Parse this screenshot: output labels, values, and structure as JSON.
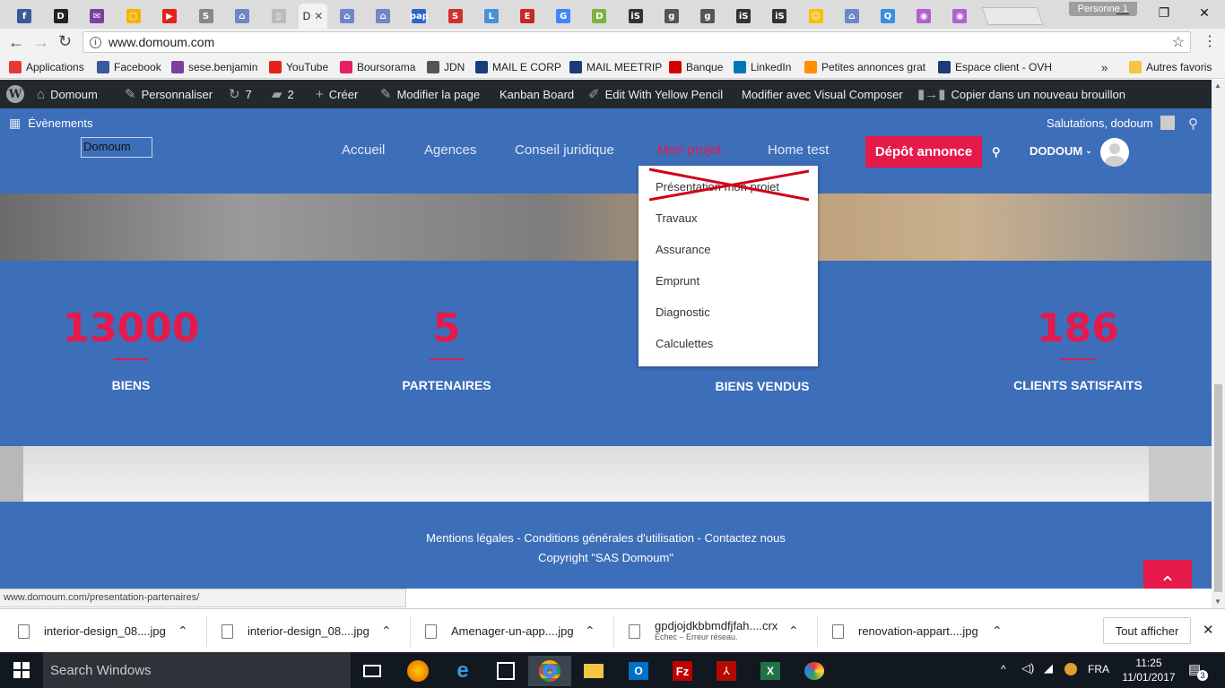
{
  "browser": {
    "profile_label": "Personne 1",
    "active_tab_title": "D",
    "tabs": [
      {
        "icon": "facebook-icon",
        "color": "#3b5998",
        "glyph": "f"
      },
      {
        "icon": "d-icon",
        "color": "#222222",
        "glyph": "D"
      },
      {
        "icon": "mail-icon",
        "color": "#7b3fa0",
        "glyph": "✉"
      },
      {
        "icon": "keep-icon",
        "color": "#f6b400",
        "glyph": "▢"
      },
      {
        "icon": "youtube-icon",
        "color": "#e62117",
        "glyph": "▶"
      },
      {
        "icon": "audio-tab-icon",
        "color": "#888888",
        "glyph": "S"
      },
      {
        "icon": "house-icon",
        "color": "#6f86c8",
        "glyph": "⌂"
      },
      {
        "icon": "doc-icon",
        "color": "#bbbbbb",
        "glyph": "▯"
      }
    ],
    "tabs_right": [
      {
        "icon": "house-icon",
        "color": "#6f86c8",
        "glyph": "⌂"
      },
      {
        "icon": "house-icon",
        "color": "#6f86c8",
        "glyph": "⌂"
      },
      {
        "icon": "pap-icon",
        "color": "#2a66c9",
        "glyph": "pap"
      },
      {
        "icon": "s-icon",
        "color": "#d32f2f",
        "glyph": "S"
      },
      {
        "icon": "li-icon",
        "color": "#4a90d9",
        "glyph": "L"
      },
      {
        "icon": "e-icon",
        "color": "#c62828",
        "glyph": "E"
      },
      {
        "icon": "google-icon",
        "color": "#4285f4",
        "glyph": "G"
      },
      {
        "icon": "d-green-icon",
        "color": "#7cb342",
        "glyph": "D"
      },
      {
        "icon": "is-icon",
        "color": "#333333",
        "glyph": "iS"
      },
      {
        "icon": "g-icon",
        "color": "#555555",
        "glyph": "g"
      },
      {
        "icon": "g-icon",
        "color": "#555555",
        "glyph": "g"
      },
      {
        "icon": "is-icon",
        "color": "#333333",
        "glyph": "iS"
      },
      {
        "icon": "is-icon",
        "color": "#333333",
        "glyph": "iS"
      },
      {
        "icon": "smile-icon",
        "color": "#f4c20d",
        "glyph": "☺"
      },
      {
        "icon": "house-icon",
        "color": "#6f86c8",
        "glyph": "⌂"
      },
      {
        "icon": "search-tab-icon",
        "color": "#3b8ee0",
        "glyph": "Q"
      },
      {
        "icon": "circle-icon",
        "color": "#b35fd0",
        "glyph": "◉"
      },
      {
        "icon": "circle-icon",
        "color": "#b35fd0",
        "glyph": "◉"
      }
    ],
    "url": "www.domoum.com",
    "bookmarks": [
      {
        "label": "Applications",
        "color": "#e53935"
      },
      {
        "label": "Facebook",
        "color": "#3b5998"
      },
      {
        "label": "sese.benjamin",
        "color": "#7b3fa0"
      },
      {
        "label": "YouTube",
        "color": "#e62117"
      },
      {
        "label": "Boursorama",
        "color": "#e91e63"
      },
      {
        "label": "JDN",
        "color": "#555555"
      },
      {
        "label": "MAIL E CORP",
        "color": "#1a3c7a"
      },
      {
        "label": "MAIL MEETRIP",
        "color": "#1a3c7a"
      },
      {
        "label": "Banque",
        "color": "#d50000"
      },
      {
        "label": "LinkedIn",
        "color": "#0077b5"
      },
      {
        "label": "Petites annonces grat",
        "color": "#ff8f00"
      },
      {
        "label": "Espace client - OVH",
        "color": "#1a3c7a"
      }
    ],
    "bookmarks_more": "»",
    "other_bookmarks": "Autres favoris"
  },
  "adminbar": {
    "site_name": "Domoum",
    "customize": "Personnaliser",
    "updates_count": "7",
    "comments_count": "2",
    "new_label": "Créer",
    "edit_page": "Modifier la page",
    "kanban": "Kanban Board",
    "yellow_pencil": "Edit With Yellow Pencil",
    "visual_composer": "Modifier avec Visual Composer",
    "copy_draft": "Copier dans un nouveau brouillon"
  },
  "site": {
    "events_label": "Évènements",
    "greeting": "Salutations, dodoum",
    "logo_alt": "Domoum",
    "nav": [
      "Accueil",
      "Agences",
      "Conseil juridique",
      "Mon projet",
      "Home test"
    ],
    "cta": "Dépôt annonce",
    "user": "DODOUM",
    "dropdown": [
      "Présentation mon projet",
      "Travaux",
      "Assurance",
      "Emprunt",
      "Diagnostic",
      "Calculettes"
    ],
    "stats": [
      {
        "value": "13000",
        "label": "BIENS"
      },
      {
        "value": "5",
        "label": "PARTENAIRES"
      },
      {
        "value": "",
        "label": "BIENS VENDUS"
      },
      {
        "value": "186",
        "label": "CLIENTS SATISFAITS"
      }
    ],
    "footer_links": "Mentions légales - Conditions générales d'utilisation - Contactez nous",
    "copyright": "Copyright \"SAS Domoum\"",
    "colors": {
      "brand": "#3d6eb9",
      "accent": "#e6194b"
    }
  },
  "status_url": "www.domoum.com/presentation-partenaires/",
  "downloads": {
    "items": [
      {
        "name": "interior-design_08....jpg",
        "sub": ""
      },
      {
        "name": "interior-design_08....jpg",
        "sub": ""
      },
      {
        "name": "Amenager-un-app....jpg",
        "sub": ""
      },
      {
        "name": "gpdjojdkbbmdfjfah....crx",
        "sub": "Échec – Erreur réseau."
      },
      {
        "name": "renovation-appart....jpg",
        "sub": ""
      }
    ],
    "show_all": "Tout afficher"
  },
  "taskbar": {
    "search_placeholder": "Search Windows",
    "lang": "FRA",
    "time": "11:25",
    "date": "11/01/2017",
    "notifications": "3"
  }
}
